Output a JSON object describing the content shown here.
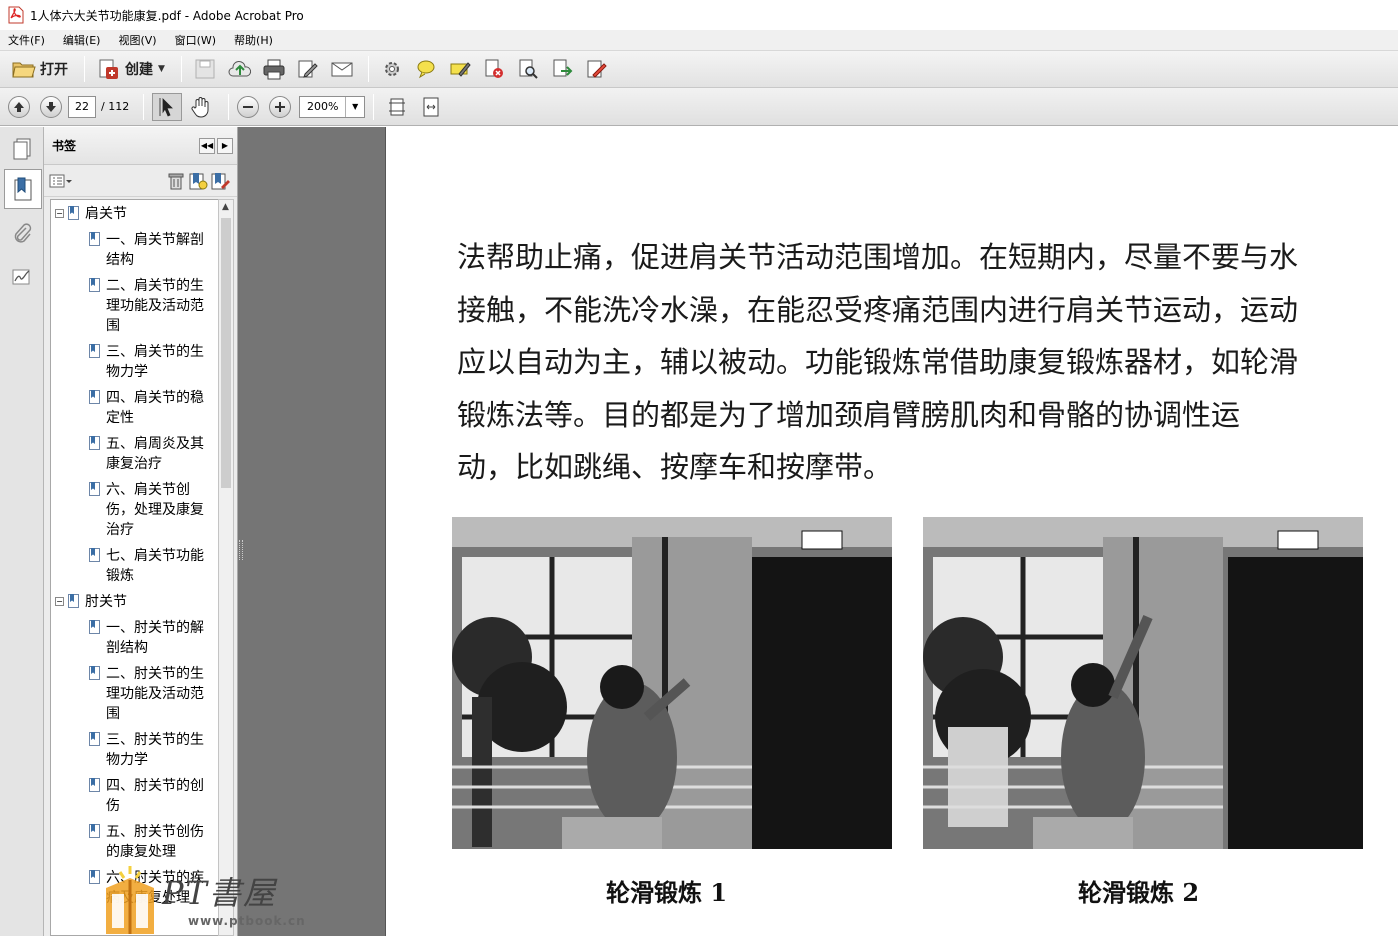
{
  "window": {
    "title": "1人体六大关节功能康复.pdf - Adobe Acrobat Pro"
  },
  "menu": [
    "文件(F)",
    "编辑(E)",
    "视图(V)",
    "窗口(W)",
    "帮助(H)"
  ],
  "toolbar": {
    "open_label": "打开",
    "create_label": "创建"
  },
  "navigation": {
    "current_page": "22",
    "total_pages": "/ 112",
    "zoom": "200%"
  },
  "bookmarks": {
    "panel_title": "书签",
    "items": [
      {
        "label": "肩关节",
        "level": 0
      },
      {
        "label": "一、肩关节解剖结构",
        "level": 1
      },
      {
        "label": "二、肩关节的生理功能及活动范围",
        "level": 1
      },
      {
        "label": "三、肩关节的生物力学",
        "level": 1
      },
      {
        "label": "四、肩关节的稳定性",
        "level": 1
      },
      {
        "label": "五、肩周炎及其康复治疗",
        "level": 1
      },
      {
        "label": "六、肩关节创伤，处理及康复治疗",
        "level": 1
      },
      {
        "label": "七、肩关节功能锻炼",
        "level": 1
      },
      {
        "label": "肘关节",
        "level": 0
      },
      {
        "label": "一、肘关节的解剖结构",
        "level": 1
      },
      {
        "label": "二、肘关节的生理功能及活动范围",
        "level": 1
      },
      {
        "label": "三、肘关节的生物力学",
        "level": 1
      },
      {
        "label": "四、肘关节的创伤",
        "level": 1
      },
      {
        "label": "五、肘关节创伤的康复处理",
        "level": 1
      },
      {
        "label": "六、肘关节的疾病及康复处理",
        "level": 1
      }
    ]
  },
  "document": {
    "lines": [
      "法帮助止痛，促进肩关节活动范围增加。在短期内，尽量不要与水",
      "接触，不能洗冷水澡，在能忍受疼痛范围内进行肩关节运动，运动",
      "应以自动为主，辅以被动。功能锻炼常借助康复锻炼器材，如轮滑",
      "锻炼法等。目的都是为了增加颈肩臂膀肌肉和骨骼的协调性运",
      "动，比如跳绳、按摩车和按摩带。"
    ],
    "captions": [
      "轮滑锻炼 1",
      "轮滑锻炼 2"
    ]
  },
  "watermark": {
    "name": "PT書屋",
    "url": "www.ptbook.cn"
  }
}
